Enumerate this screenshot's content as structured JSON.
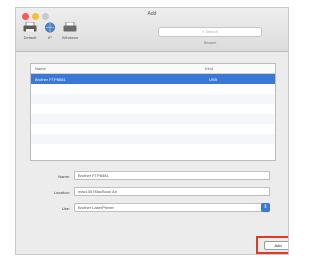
{
  "window": {
    "title": "Add"
  },
  "toolbar": {
    "default_label": "Default",
    "ip_label": "IP",
    "windows_label": "Windows",
    "search_placeholder": "Search",
    "search_label": "Search"
  },
  "list": {
    "columns": [
      "Name",
      "Kind"
    ],
    "rows": [
      {
        "name": "Brother FTP8581",
        "kind": "USB",
        "selected": true
      },
      {
        "name": "",
        "kind": "",
        "selected": false
      },
      {
        "name": "",
        "kind": "",
        "selected": false
      },
      {
        "name": "",
        "kind": "",
        "selected": false
      },
      {
        "name": "",
        "kind": "",
        "selected": false
      },
      {
        "name": "",
        "kind": "",
        "selected": false
      },
      {
        "name": "",
        "kind": "",
        "selected": false
      },
      {
        "name": "",
        "kind": "",
        "selected": false
      }
    ]
  },
  "form": {
    "name_label": "Name:",
    "name_value": "Brother FTP8581",
    "location_label": "Location:",
    "location_value": "mac1057MacBook Air",
    "use_label": "Use:",
    "use_value": "Brother LaserPrinter"
  },
  "actions": {
    "add_label": "Add"
  },
  "colors": {
    "selection": "#3a78d6",
    "highlight": "#e03a22"
  }
}
